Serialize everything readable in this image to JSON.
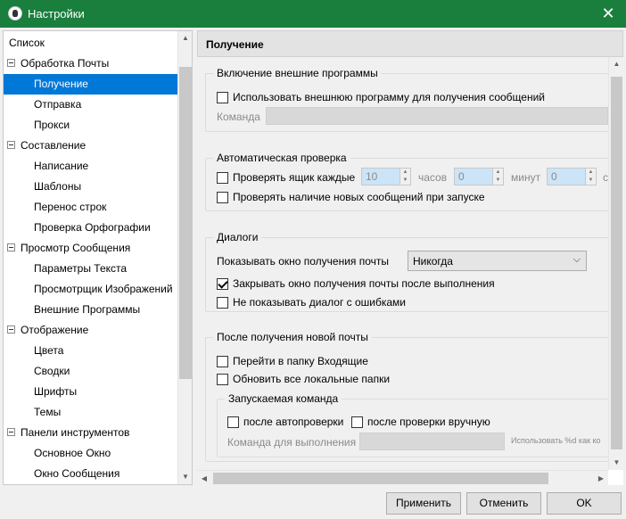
{
  "window": {
    "title": "Настройки",
    "close_glyph": "✕"
  },
  "tree": {
    "items": [
      {
        "label": "Список",
        "level": 0,
        "expander": false,
        "selected": false
      },
      {
        "label": "Обработка Почты",
        "level": 0,
        "expander": true,
        "selected": false
      },
      {
        "label": "Получение",
        "level": 1,
        "expander": false,
        "selected": true
      },
      {
        "label": "Отправка",
        "level": 1,
        "expander": false,
        "selected": false
      },
      {
        "label": "Прокси",
        "level": 1,
        "expander": false,
        "selected": false
      },
      {
        "label": "Составление",
        "level": 0,
        "expander": true,
        "selected": false
      },
      {
        "label": "Написание",
        "level": 1,
        "expander": false,
        "selected": false
      },
      {
        "label": "Шаблоны",
        "level": 1,
        "expander": false,
        "selected": false
      },
      {
        "label": "Перенос строк",
        "level": 1,
        "expander": false,
        "selected": false
      },
      {
        "label": "Проверка Орфографии",
        "level": 1,
        "expander": false,
        "selected": false
      },
      {
        "label": "Просмотр Сообщения",
        "level": 0,
        "expander": true,
        "selected": false
      },
      {
        "label": "Параметры Текста",
        "level": 1,
        "expander": false,
        "selected": false
      },
      {
        "label": "Просмотрщик Изображений",
        "level": 1,
        "expander": false,
        "selected": false
      },
      {
        "label": "Внешние Программы",
        "level": 1,
        "expander": false,
        "selected": false
      },
      {
        "label": "Отображение",
        "level": 0,
        "expander": true,
        "selected": false
      },
      {
        "label": "Цвета",
        "level": 1,
        "expander": false,
        "selected": false
      },
      {
        "label": "Сводки",
        "level": 1,
        "expander": false,
        "selected": false
      },
      {
        "label": "Шрифты",
        "level": 1,
        "expander": false,
        "selected": false
      },
      {
        "label": "Темы",
        "level": 1,
        "expander": false,
        "selected": false
      },
      {
        "label": "Панели инструментов",
        "level": 0,
        "expander": true,
        "selected": false
      },
      {
        "label": "Основное Окно",
        "level": 1,
        "expander": false,
        "selected": false
      },
      {
        "label": "Окно Сообщения",
        "level": 1,
        "expander": false,
        "selected": false
      }
    ]
  },
  "page": {
    "title": "Получение",
    "external": {
      "group_title": "Включение внешние программы",
      "use_external_label": "Использовать внешнюю программу для получения сообщений",
      "use_external_checked": false,
      "command_label": "Команда",
      "command_value": ""
    },
    "auto_check": {
      "group_title": "Автоматическая проверка",
      "check_every_label": "Проверять ящик каждые",
      "check_every_checked": false,
      "hours_value": "10",
      "hours_label": "часов",
      "minutes_value": "0",
      "minutes_label": "минут",
      "seconds_value": "0",
      "seconds_label": "с",
      "check_on_start_label": "Проверять наличие новых сообщений при запуске",
      "check_on_start_checked": false
    },
    "dialogs": {
      "group_title": "Диалоги",
      "show_window_label": "Показывать окно получения почты",
      "show_window_value": "Никогда",
      "close_after_label": "Закрывать окно получения почты после выполнения",
      "close_after_checked": true,
      "no_error_dialog_label": "Не показывать диалог с ошибками",
      "no_error_dialog_checked": false
    },
    "after_receive": {
      "group_title": "После получения новой почты",
      "goto_inbox_label": "Перейти в папку Входящие",
      "goto_inbox_checked": false,
      "update_local_label": "Обновить все локальные папки",
      "update_local_checked": false,
      "run_command": {
        "group_title": "Запускаемая команда",
        "after_auto_label": "после автопроверки",
        "after_auto_checked": false,
        "after_manual_label": "после проверки вручную",
        "after_manual_checked": false,
        "command_label": "Команда для выполнения",
        "command_value": "",
        "hint": "Использовать %d как ко"
      }
    }
  },
  "buttons": {
    "apply": "Применить",
    "cancel": "Отменить",
    "ok": "OK"
  },
  "colors": {
    "titlebar": "#1a7f3c",
    "selection": "#0078d7"
  }
}
